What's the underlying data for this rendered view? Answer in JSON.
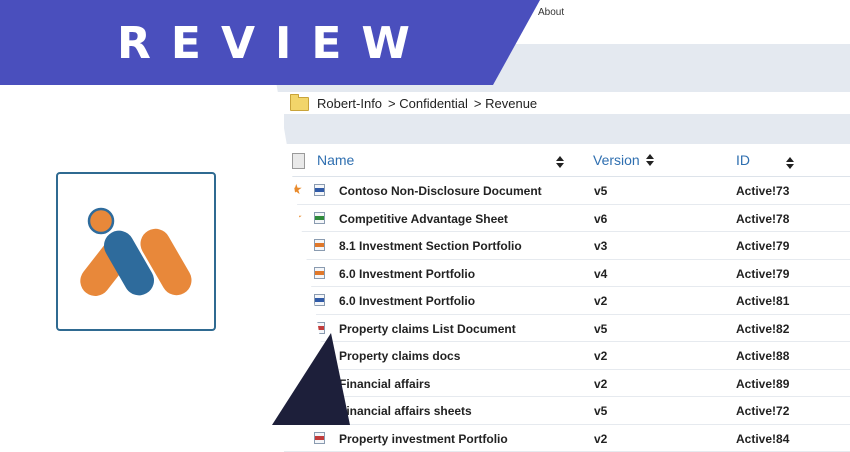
{
  "banner": {
    "title": "REVIEW",
    "color": "#4a4fbd"
  },
  "topbar": {
    "about_label": "About"
  },
  "breadcrumb": {
    "segments": [
      "Robert-Info",
      "> Confidential",
      "> Revenue"
    ]
  },
  "table": {
    "columns": {
      "name": "Name",
      "version": "Version",
      "id": "ID"
    },
    "rows": [
      {
        "starred": true,
        "icon": "pdf-file-icon",
        "name": "Contoso Non-Disclosure Document",
        "version": "v5",
        "id": "Active!73"
      },
      {
        "starred": true,
        "icon": "excel-file-icon",
        "name": "Competitive Advantage Sheet",
        "version": "v6",
        "id": "Active!78"
      },
      {
        "starred": false,
        "icon": "ppt-file-icon",
        "name": "8.1 Investment Section Portfolio",
        "version": "v3",
        "id": "Active!79"
      },
      {
        "starred": false,
        "icon": "ppt-file-icon",
        "name": "6.0 Investment Portfolio",
        "version": "v4",
        "id": "Active!79"
      },
      {
        "starred": false,
        "icon": "pdf-file-icon",
        "name": "6.0 Investment Portfolio",
        "version": "v2",
        "id": "Active!81"
      },
      {
        "starred": false,
        "icon": "doc-file-icon",
        "name": "Property claims List Document",
        "version": "v5",
        "id": "Active!82"
      },
      {
        "starred": false,
        "icon": "doc-file-icon",
        "name": "Property claims docs",
        "version": "v2",
        "id": "Active!88"
      },
      {
        "starred": false,
        "icon": "doc-file-icon",
        "name": "Financial affairs",
        "version": "v2",
        "id": "Active!89"
      },
      {
        "starred": false,
        "icon": "doc-file-icon",
        "name": "Financial affairs sheets",
        "version": "v5",
        "id": "Active!72"
      },
      {
        "starred": false,
        "icon": "doc-file-icon",
        "name": "Property investment Portfolio",
        "version": "v2",
        "id": "Active!84"
      }
    ]
  },
  "colors": {
    "accent_blue": "#2f6fb0",
    "star_orange": "#e98a2b",
    "logo_orange": "#e8883a",
    "logo_blue": "#2e6b9c",
    "navy": "#1d1f3a"
  }
}
